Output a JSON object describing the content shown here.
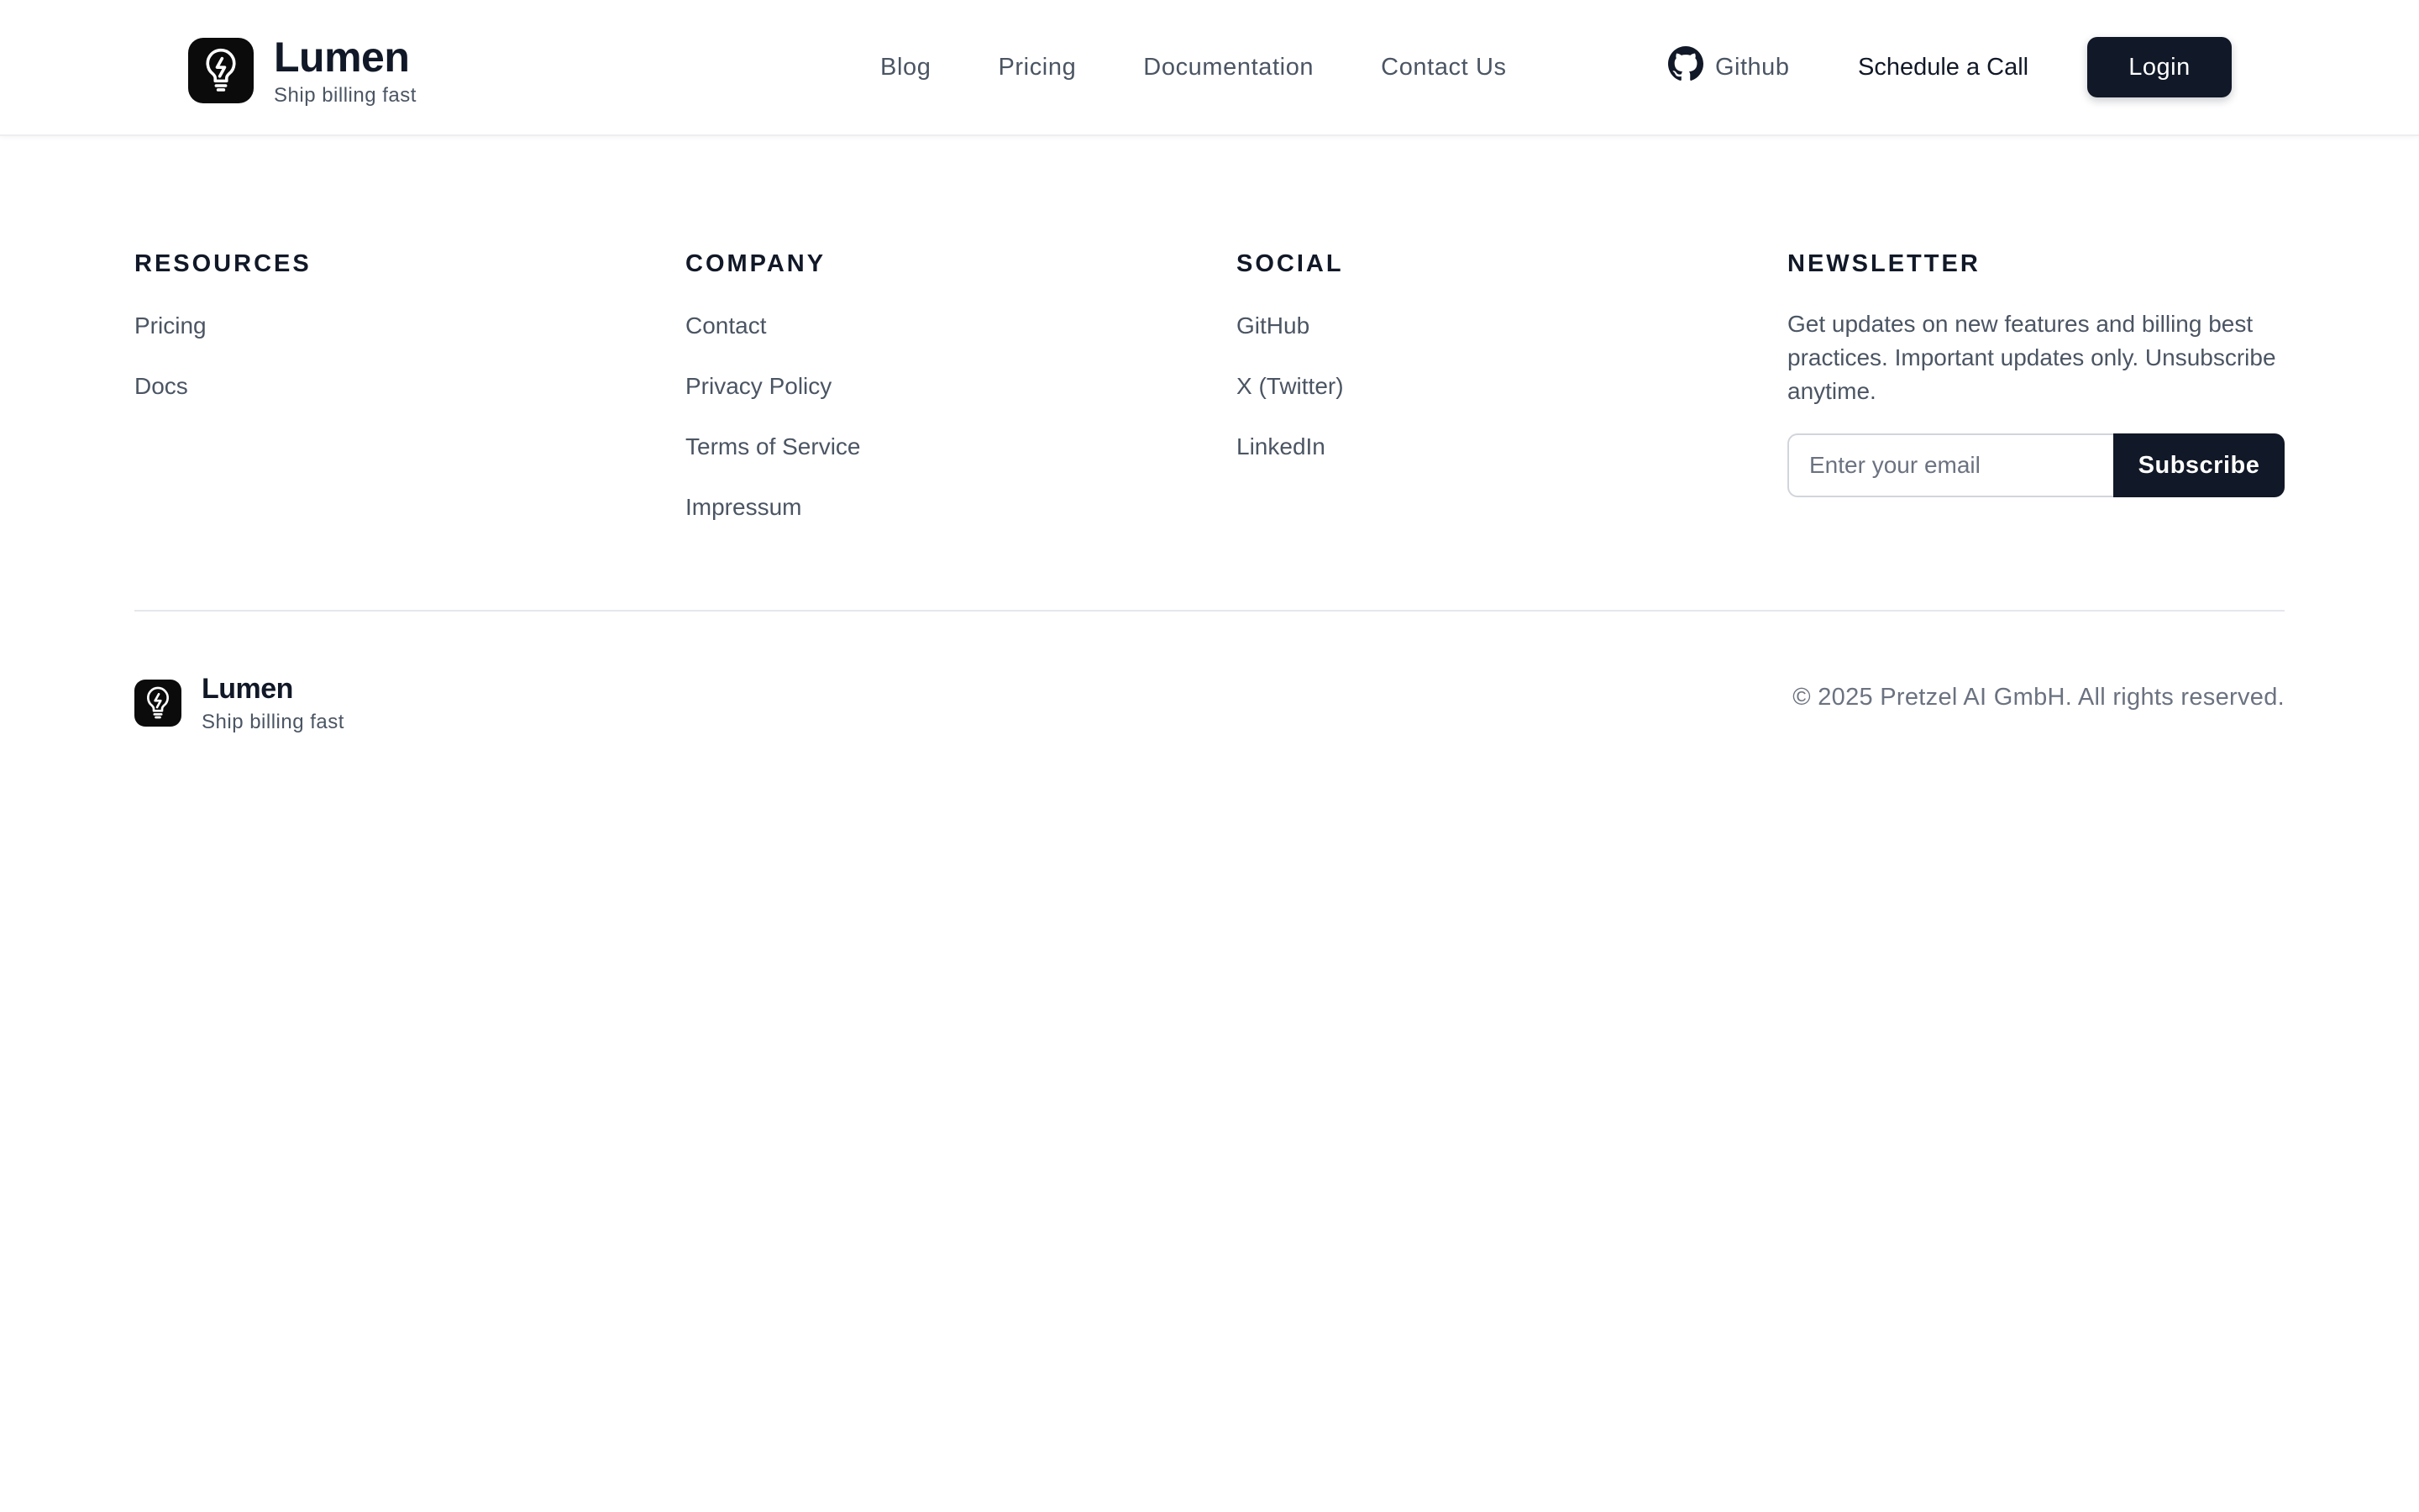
{
  "brand": {
    "name": "Lumen",
    "tagline": "Ship billing fast"
  },
  "nav": {
    "items": [
      "Blog",
      "Pricing",
      "Documentation",
      "Contact Us"
    ],
    "github_label": "Github",
    "schedule_label": "Schedule a Call",
    "login_label": "Login"
  },
  "footer": {
    "resources": {
      "title": "RESOURCES",
      "links": [
        "Pricing",
        "Docs"
      ]
    },
    "company": {
      "title": "COMPANY",
      "links": [
        "Contact",
        "Privacy Policy",
        "Terms of Service",
        "Impressum"
      ]
    },
    "social": {
      "title": "SOCIAL",
      "links": [
        "GitHub",
        "X (Twitter)",
        "LinkedIn"
      ]
    },
    "newsletter": {
      "title": "NEWSLETTER",
      "description": "Get updates on new features and billing best practices. Important updates only. Unsubscribe anytime.",
      "email_placeholder": "Enter your email",
      "subscribe_label": "Subscribe"
    },
    "copyright": "© 2025 Pretzel AI GmbH. All rights reserved."
  },
  "icons": {
    "logo": "lightbulb-bolt-icon",
    "github": "github-icon"
  },
  "colors": {
    "primary_dark": "#111827",
    "text_muted": "#4b5563",
    "divider": "#e5e7eb",
    "page_background": "#ffffff"
  }
}
